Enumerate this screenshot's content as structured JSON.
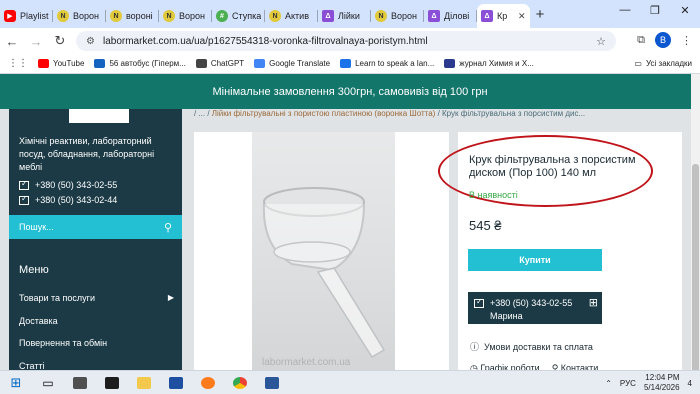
{
  "browser": {
    "tabs": [
      {
        "label": "Playlist",
        "icon": "youtube-icon",
        "fav": "yt",
        "fav_text": "▶"
      },
      {
        "label": "Ворон",
        "icon": "site-icon",
        "fav": "yel",
        "fav_text": "N"
      },
      {
        "label": "вороні",
        "icon": "site-icon",
        "fav": "yel",
        "fav_text": "N"
      },
      {
        "label": "Ворон",
        "icon": "site-icon",
        "fav": "yel",
        "fav_text": "N"
      },
      {
        "label": "Ступка",
        "icon": "site-icon",
        "fav": "grn",
        "fav_text": "#"
      },
      {
        "label": "Актив",
        "icon": "site-icon",
        "fav": "yel",
        "fav_text": "N"
      },
      {
        "label": "Лійки",
        "icon": "flask-icon",
        "fav": "pur",
        "fav_text": "Δ"
      },
      {
        "label": "Ворон",
        "icon": "site-icon",
        "fav": "yel",
        "fav_text": "N"
      },
      {
        "label": "Ділові",
        "icon": "flask-icon",
        "fav": "pur",
        "fav_text": "Δ"
      },
      {
        "label": "Кр",
        "icon": "flask-icon",
        "fav": "pur",
        "fav_text": "Δ",
        "active": true
      }
    ],
    "new_tab": "+",
    "url": "labormarket.com.ua/ua/p1627554318-voronka-filtrovalnaya-poristym.html",
    "bookmarks": [
      {
        "label": "YouTube",
        "color": "#ff0000"
      },
      {
        "label": "56 автобус (Гіперм...",
        "color": "#1565c0"
      },
      {
        "label": "ChatGPT",
        "color": "#444444"
      },
      {
        "label": "Google Translate",
        "color": "#4285f4"
      },
      {
        "label": "Learn to speak a lan...",
        "color": "#1a73e8"
      },
      {
        "label": "журнал Химия и Х...",
        "color": "#2b3a8c"
      }
    ],
    "all_bookmarks": "Усі закладки",
    "profile_initial": "B"
  },
  "site": {
    "banner": "Мінімальне замовлення 300грн, самовивіз від 100 грн",
    "tagline": "Хімічні реактиви, лабораторний посуд, обладнання, лабораторні меблі",
    "phones": [
      "+380 (50) 343-02-55",
      "+380 (50) 343-02-44"
    ],
    "search_placeholder": "Пошук...",
    "menu_title": "Меню",
    "menu_items": [
      "Товари та послуги",
      "Доставка",
      "Повернення та обмін",
      "Статті"
    ],
    "breadcrumb_prefix": "/ ... / ",
    "breadcrumb_link": "Лійки фільтрувальні з пористою пластиною (воронка Шотта)",
    "breadcrumb_current": "/ Крук фільтрувальна з порсистим дис...",
    "watermark": "labormarket.com.ua"
  },
  "product": {
    "title": "Крук фільтрувальна з порсистим диском (Пор 100) 140 мл",
    "stock": "В наявності",
    "price": "545 ₴",
    "buy_label": "Купити",
    "contact_phone": "+380 (50) 343-02-55",
    "contact_name": "Марина",
    "terms": "Умови доставки та сплата",
    "bottom_links": [
      "Графік роботи",
      "Контакти"
    ],
    "highlight_color": "#c0141b"
  },
  "taskbar": {
    "lang": "РУС",
    "time": "12:04 PM",
    "date": "5/14/2026",
    "notifications": "4"
  }
}
